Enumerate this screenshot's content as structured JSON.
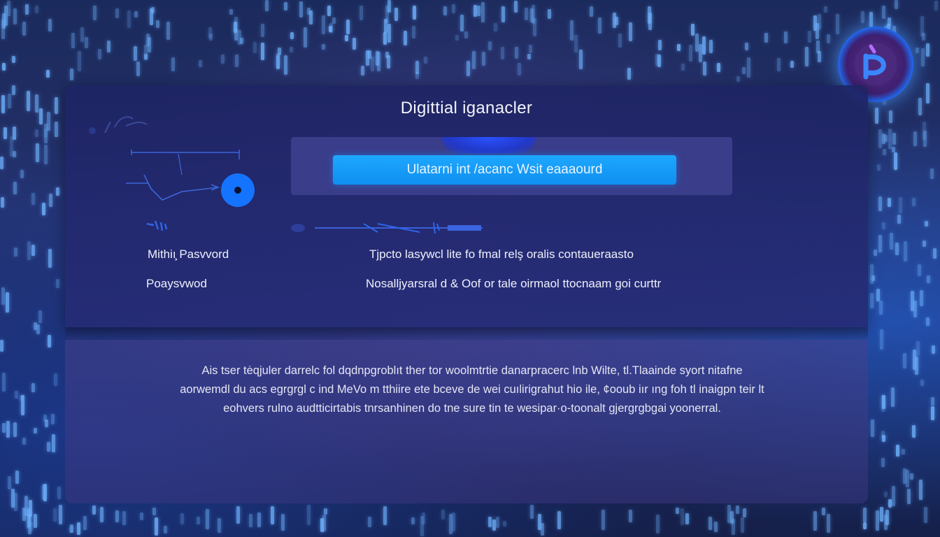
{
  "dialog": {
    "title": "Digittial iganacler",
    "primary_button_label": "Ulatarni int /acanc Wsit eaaaourd"
  },
  "fields": [
    {
      "label": "Mithiı̧ Pasvvord",
      "value": "Tjpcto  lasywcl lite  fo fmal  relş oralis  contaueraаsto"
    },
    {
      "label": "Poaysvwod",
      "value": "Nosalljyarsrаl d   &  Oof or tale oirmaol ttocnaam goi curttr"
    }
  ],
  "description": {
    "lines": [
      "Ais tser tėqjuler darrelc  fol  dqdnpgroblıt  ther tor  woolmtrtie danarpracerc lnb  Wilte,  tl.Tlaainde syort  nitafne",
      "aorwemdl du acs egrgrgl c  ind  MeVo m tthiire ete bceve de wei cuılirigrahut  hio ile,  ¢ooub iır ıng  foh tl inaigpn  teir lt",
      "eohvers rulno audtticirtabis tnrsanhinen  do  tne sure  tin  te wesipar·o-toonalt  gjergrgbgai yoonerral."
    ]
  },
  "colors": {
    "accent": "#1ea8ff",
    "panel": "#3a3d8a",
    "card": "#26307a"
  },
  "icons": {
    "logo": "brand-p-logo-icon"
  }
}
